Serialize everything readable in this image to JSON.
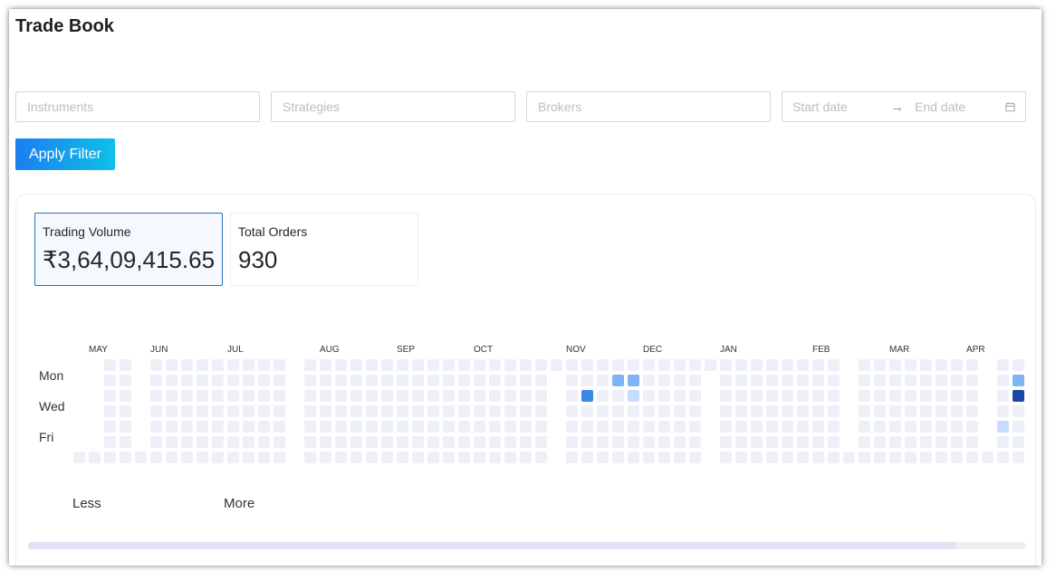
{
  "page": {
    "title": "Trade Book"
  },
  "filters": {
    "instruments_placeholder": "Instruments",
    "strategies_placeholder": "Strategies",
    "brokers_placeholder": "Brokers",
    "start_date_placeholder": "Start date",
    "end_date_placeholder": "End date",
    "arrow": "→",
    "calendar_icon": "calendar-icon",
    "apply_label": "Apply Filter"
  },
  "stats": {
    "trading_volume_label": "Trading Volume",
    "trading_volume_value": "₹3,64,09,415.65",
    "total_orders_label": "Total Orders",
    "total_orders_value": "930"
  },
  "heatmap": {
    "months": [
      "MAY",
      "JUN",
      "JUL",
      "AUG",
      "SEP",
      "OCT",
      "NOV",
      "DEC",
      "JAN",
      "FEB",
      "MAR",
      "APR"
    ],
    "day_labels": [
      "Mon",
      "Wed",
      "Fri"
    ],
    "legend_less": "Less",
    "legend_more": "More",
    "colors": [
      "#eef0f8",
      "#c5dcff",
      "#7eb3f4",
      "#3a87e6",
      "#1947a3"
    ]
  }
}
